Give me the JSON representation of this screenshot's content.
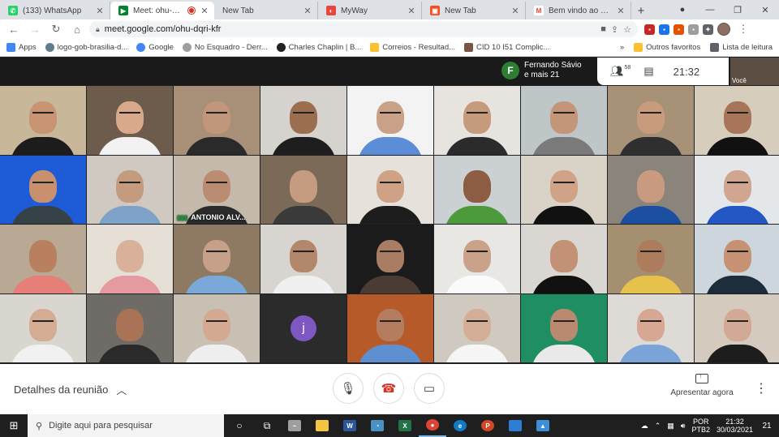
{
  "browser": {
    "tabs": [
      {
        "title": "(133) WhatsApp",
        "color": "#25d366",
        "glyph": "✆"
      },
      {
        "title": "Meet: ohu-dqri-kfr",
        "color": "#00832d",
        "glyph": "▶",
        "active": true,
        "recording": true
      },
      {
        "title": "New Tab",
        "color": "#ffffff",
        "glyph": ""
      },
      {
        "title": "MyWay",
        "color": "#e8453c",
        "glyph": "◐"
      },
      {
        "title": "New Tab",
        "color": "#f4511e",
        "glyph": "▣"
      },
      {
        "title": "Bem vindo ao Conta C",
        "color": "#ea4335",
        "glyph": "M"
      }
    ],
    "new_tab_glyph": "+",
    "window_controls": [
      "●",
      "—",
      "❐",
      "✕"
    ],
    "url": "meet.google.com/ohu-dqri-kfr",
    "bookmarks": [
      {
        "label": "Apps",
        "color": "#4285f4"
      },
      {
        "label": "logo-gob-brasilia-d...",
        "color": "#607d8b"
      },
      {
        "label": "Google",
        "color": "#4285f4"
      },
      {
        "label": "No Esquadro - Derr...",
        "color": "#9e9e9e"
      },
      {
        "label": "Charles Chaplin | B...",
        "color": "#212121"
      },
      {
        "label": "Correios - Resultad...",
        "color": "#fbc02d"
      },
      {
        "label": "CID 10 I51 Complic...",
        "color": "#795548"
      }
    ],
    "bookmarks_overflow": "»",
    "other_bookmarks": "Outros favoritos",
    "reading_list": "Lista de leitura"
  },
  "meet": {
    "presenter_initial": "F",
    "presenter_name": "Fernando Sávio",
    "presenter_more": "e mais 21",
    "participants_count": "58",
    "clock": "21:32",
    "self_label": "Você",
    "speaking_label": "ANTONIO ALV...",
    "avatar_initial": "j",
    "meeting_details": "Detalhes da reunião",
    "present_now": "Apresentar agora",
    "tiles": [
      {
        "bg": "#c9b79a",
        "skin": "#c89474",
        "shirt": "#1c1c1c",
        "glasses": true
      },
      {
        "bg": "#6d5b4b",
        "skin": "#d8a98a",
        "shirt": "#f2f2f2",
        "glasses": true
      },
      {
        "bg": "#a88f77",
        "skin": "#c2967a",
        "shirt": "#2a2a2a",
        "glasses": true
      },
      {
        "bg": "#d6d3cf",
        "skin": "#9a6e4f",
        "shirt": "#1e1e1e",
        "glasses": true
      },
      {
        "bg": "#f3f3f3",
        "skin": "#c9a189",
        "shirt": "#5b8ed6",
        "glasses": true
      },
      {
        "bg": "#e7e4df",
        "skin": "#c69a7c",
        "shirt": "#2b2b2b",
        "glasses": true
      },
      {
        "bg": "#bfc6c8",
        "skin": "#c49679",
        "shirt": "#7a7a7a",
        "glasses": true
      },
      {
        "bg": "#a79278",
        "skin": "#c99b7d",
        "shirt": "#2f2f2f",
        "glasses": true
      },
      {
        "bg": "#d7cdbd",
        "skin": "#a6755a",
        "shirt": "#111111",
        "glasses": true
      },
      {
        "bg": "#1e5bd6",
        "skin": "#c8906e",
        "shirt": "#374248",
        "glasses": true
      },
      {
        "bg": "#cfc9c2",
        "skin": "#c59b80",
        "shirt": "#7fa2c8",
        "glasses": true
      },
      {
        "bg": "#c4b9ab",
        "skin": "#ba8d72",
        "shirt": "#2b2b2b",
        "glasses": true,
        "speaking": true
      },
      {
        "bg": "#7b6a58",
        "skin": "#c59c80",
        "shirt": "#3a3a3a",
        "glasses": false
      },
      {
        "bg": "#e6e1da",
        "skin": "#cfa185",
        "shirt": "#1d1d1d",
        "glasses": true
      },
      {
        "bg": "#cbd0d2",
        "skin": "#8c5d43",
        "shirt": "#4c9a3c",
        "glasses": false
      },
      {
        "bg": "#d9d2c7",
        "skin": "#d0a287",
        "shirt": "#111111",
        "glasses": true
      },
      {
        "bg": "#8a847b",
        "skin": "#c89b80",
        "shirt": "#1d4fa0",
        "glasses": false
      },
      {
        "bg": "#e3e7ea",
        "skin": "#d1a690",
        "shirt": "#2457c4",
        "glasses": true
      },
      {
        "bg": "#b8a894",
        "skin": "#b9805f",
        "shirt": "#e57f78",
        "glasses": false
      },
      {
        "bg": "#e6dfd6",
        "skin": "#d9b19a",
        "shirt": "#e59aa0",
        "glasses": false
      },
      {
        "bg": "#8e7a62",
        "skin": "#c7a08a",
        "shirt": "#7aa8d8",
        "glasses": true
      },
      {
        "bg": "#d8d5d1",
        "skin": "#b3876c",
        "shirt": "#f0f0f0",
        "glasses": true
      },
      {
        "bg": "#1b1b1b",
        "skin": "#a97d63",
        "shirt": "#4a3b34",
        "glasses": true
      },
      {
        "bg": "#e9e7e3",
        "skin": "#c9a289",
        "shirt": "#fafafa",
        "glasses": true
      },
      {
        "bg": "#dad7d3",
        "skin": "#c39175",
        "shirt": "#111111",
        "glasses": false
      },
      {
        "bg": "#a49071",
        "skin": "#ad7c5c",
        "shirt": "#e6c24c",
        "glasses": true
      },
      {
        "bg": "#cdd6dc",
        "skin": "#c69273",
        "shirt": "#1d2d3b",
        "glasses": true
      },
      {
        "bg": "#d9d5cf",
        "skin": "#d4ab93",
        "shirt": "#f1f1f1",
        "glasses": true
      },
      {
        "bg": "#6f6b66",
        "skin": "#a97455",
        "shirt": "#2a2a2a",
        "glasses": false
      },
      {
        "bg": "#c9c0b4",
        "skin": "#d3a992",
        "shirt": "#eeeeee",
        "glasses": true
      },
      {
        "bg": "#2b2b2b",
        "skin": "#2b2b2b",
        "shirt": "#2b2b2b",
        "glasses": false,
        "avatar": true
      },
      {
        "bg": "#b65a2a",
        "skin": "#b57d60",
        "shirt": "#5d8fd1",
        "glasses": true
      },
      {
        "bg": "#cfc9bf",
        "skin": "#d5ae97",
        "shirt": "#f5f5f5",
        "glasses": true
      },
      {
        "bg": "#1f8f63",
        "skin": "#b98a6f",
        "shirt": "#e9e9e9",
        "glasses": true
      },
      {
        "bg": "#dedbd7",
        "skin": "#d7a793",
        "shirt": "#7aa4d8",
        "glasses": true
      },
      {
        "bg": "#d4cabd",
        "skin": "#d2a995",
        "shirt": "#1d1d1d",
        "glasses": true
      }
    ]
  },
  "taskbar": {
    "search_placeholder": "Digite aqui para pesquisar",
    "lang_top": "POR",
    "lang_bottom": "PTB2",
    "time": "21:32",
    "date": "30/03/2021",
    "notifications": "21"
  }
}
